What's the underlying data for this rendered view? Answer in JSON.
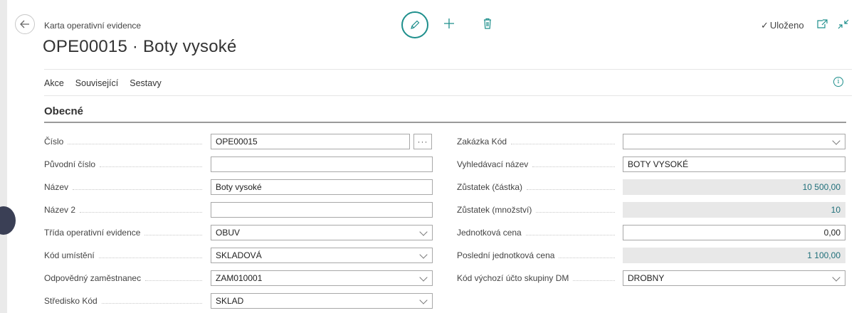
{
  "header": {
    "caption": "Karta operativní evidence",
    "title": "OPE00015 · Boty vysoké",
    "saved_label": "Uloženo",
    "icons": {
      "back": "arrow-left-icon",
      "edit": "pencil-icon",
      "add": "plus-icon",
      "delete": "trash-icon",
      "open_new": "open-new-window-icon",
      "collapse": "collapse-icon",
      "info": "info-icon"
    },
    "accent_color": "#1e8f8c"
  },
  "menu": {
    "items": [
      "Akce",
      "Související",
      "Sestavy"
    ]
  },
  "section": {
    "title": "Obecné"
  },
  "fields_left": [
    {
      "label": "Číslo",
      "value": "OPE00015",
      "type": "lookup"
    },
    {
      "label": "Původní číslo",
      "value": "",
      "type": "text"
    },
    {
      "label": "Název",
      "value": "Boty vysoké",
      "type": "text"
    },
    {
      "label": "Název 2",
      "value": "",
      "type": "text"
    },
    {
      "label": "Třída operativní evidence",
      "value": "OBUV",
      "type": "dropdown"
    },
    {
      "label": "Kód umístění",
      "value": "SKLADOVÁ",
      "type": "dropdown"
    },
    {
      "label": "Odpovědný zaměstnanec",
      "value": "ZAM010001",
      "type": "dropdown"
    },
    {
      "label": "Středisko Kód",
      "value": "SKLAD",
      "type": "dropdown"
    }
  ],
  "fields_right": [
    {
      "label": "Zakázka Kód",
      "value": "",
      "type": "dropdown"
    },
    {
      "label": "Vyhledávací název",
      "value": "BOTY VYSOKÉ",
      "type": "text"
    },
    {
      "label": "Zůstatek (částka)",
      "value": "10 500,00",
      "type": "readonly"
    },
    {
      "label": "Zůstatek (množství)",
      "value": "10",
      "type": "readonly"
    },
    {
      "label": "Jednotková cena",
      "value": "0,00",
      "type": "number"
    },
    {
      "label": "Poslední jednotková cena",
      "value": "1 100,00",
      "type": "readonly"
    },
    {
      "label": "Kód výchozí účto skupiny DM",
      "value": "DROBNY",
      "type": "dropdown"
    }
  ],
  "lookup_glyph": "···"
}
